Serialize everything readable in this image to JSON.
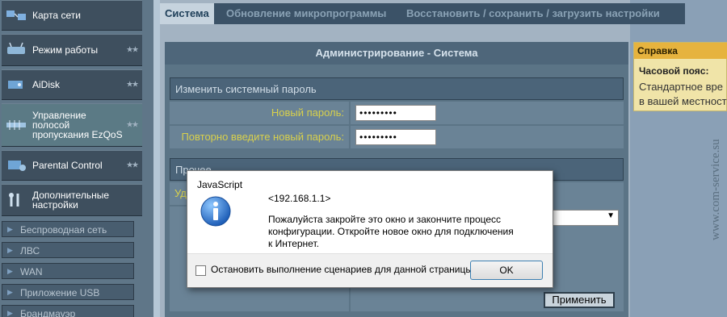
{
  "sidebar": {
    "items": [
      {
        "label": "Карта сети",
        "icon": "network-map-icon"
      },
      {
        "label": "Режим работы",
        "icon": "router-icon"
      },
      {
        "label": "AiDisk",
        "icon": "disk-icon"
      },
      {
        "label": "Управление полосой пропускания EzQoS",
        "icon": "qos-icon"
      },
      {
        "label": "Parental Control",
        "icon": "parental-control-icon"
      },
      {
        "label": "Дополнительные настройки",
        "icon": "tools-icon"
      }
    ],
    "subitems": [
      "Беспроводная сеть",
      "ЛВС",
      "WAN",
      "Приложение USB",
      "Брандмауэр"
    ],
    "stars": "★★"
  },
  "tabs": [
    "Система",
    "Обновление микропрограммы",
    "Восстановить / сохранить / загрузить настройки"
  ],
  "panel": {
    "title": "Администрирование - Система",
    "password_section": "Изменить системный пароль",
    "new_password_label": "Новый пароль:",
    "new_password_value": "•••••••••",
    "repeat_password_label": "Повторно введите новый пароль:",
    "repeat_password_value": "•••••••••",
    "misc_section": "Прочее",
    "partial_label": "Уд",
    "apply_label": "Применить"
  },
  "help": {
    "title": "Справка",
    "subtitle": "Часовой пояс:",
    "line1": "Стандартное вре",
    "line2": "в вашей местност"
  },
  "watermark": "www.com-service.su",
  "dialog": {
    "title": "JavaScript",
    "host": "<192.168.1.1>",
    "message_line1": "Пожалуйста закройте это окно и закончите процесс",
    "message_line2": "конфигурации. Откройте новое окно для подключения",
    "message_line3": "к Интернет.",
    "checkbox_label": "Остановить выполнение сценариев для данной страницы",
    "ok_label": "OK"
  },
  "colors": {
    "sidebar_bg": "#5f7688",
    "tab_bar": "#3b5267",
    "active_tab": "#c6d3de",
    "label_yellow": "#d8d04c",
    "help_header": "#e6b33e",
    "ok_border": "#3c7fb1"
  }
}
